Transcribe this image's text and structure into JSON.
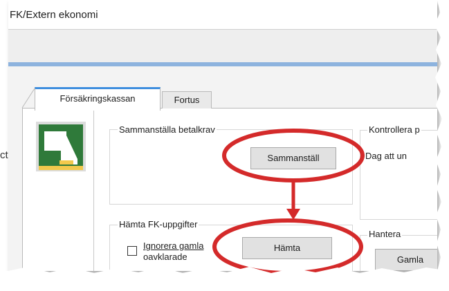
{
  "page": {
    "fragment_text": "ct"
  },
  "window": {
    "title": "FK/Extern ekonomi"
  },
  "tabs": [
    {
      "label": "Försäkringskassan",
      "active": true
    },
    {
      "label": "Fortus",
      "active": false
    }
  ],
  "groups": {
    "sammanstalla": {
      "title": "Sammanställa betalkrav",
      "button_label": "Sammanställ"
    },
    "hamta": {
      "title": "Hämta FK-uppgifter",
      "checkbox_label_line1": "Ignorera gamla",
      "checkbox_label_line2": "oavklarade",
      "button_label": "Hämta"
    },
    "kontrollera": {
      "title": "Kontrollera p",
      "day_label": "Dag att un"
    },
    "hantera": {
      "title": "Hantera",
      "button_label": "Gamla"
    }
  },
  "colors": {
    "annotation": "#d42a2a",
    "tab_accent": "#3e8ede",
    "logo_green": "#2f7a3a",
    "logo_yellow": "#f2c94c"
  }
}
